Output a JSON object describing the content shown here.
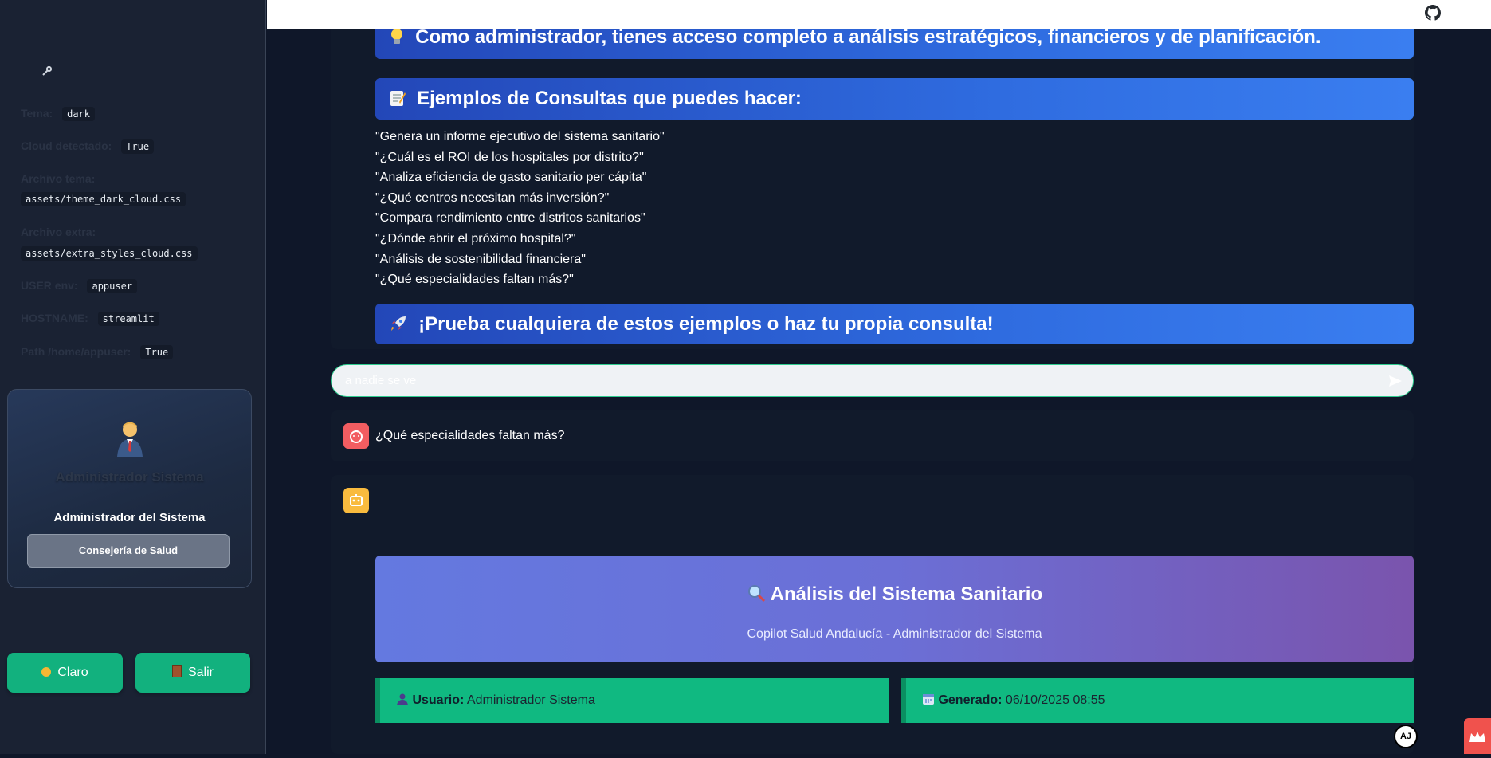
{
  "sidebar": {
    "config": [
      {
        "label": "Tema:",
        "value": "dark"
      },
      {
        "label": "Cloud detectado:",
        "value": "True"
      },
      {
        "label": "Archivo tema:",
        "value": "assets/theme_dark_cloud.css"
      },
      {
        "label": "Archivo extra:",
        "value": "assets/extra_styles_cloud.css"
      },
      {
        "label": "USER env:",
        "value": "appuser"
      },
      {
        "label": "HOSTNAME:",
        "value": "streamlit"
      },
      {
        "label": "Path /home/appuser:",
        "value": "True"
      }
    ],
    "user_card": {
      "avatar_icon": "businessman-emoji-icon",
      "name": "Administrador Sistema",
      "role": "Administrador del Sistema",
      "organization": "Consejería de Salud"
    },
    "buttons": {
      "theme_label": "Claro",
      "logout_label": "Salir"
    }
  },
  "main": {
    "admin_banner": "Como administrador, tienes acceso completo a análisis estratégicos, financieros y de planificación.",
    "examples_title": "Ejemplos de Consultas que puedes hacer:",
    "examples": [
      "\"Genera un informe ejecutivo del sistema sanitario\"",
      "\"¿Cuál es el ROI de los hospitales por distrito?\"",
      "\"Analiza eficiencia de gasto sanitario per cápita\"",
      "\"¿Qué centros necesitan más inversión?\"",
      "\"Compara rendimiento entre distritos sanitarios\"",
      "\"¿Dónde abrir el próximo hospital?\"",
      "\"Análisis de sostenibilidad financiera\"",
      "\"¿Qué especialidades faltan más?\""
    ],
    "cta_banner": "¡Prueba cualquiera de estos ejemplos o haz tu propia consulta!",
    "chat_input": {
      "value": "a nadie se ve"
    },
    "user_message": "¿Qué especialidades faltan más?",
    "report": {
      "title": "Análisis del Sistema Sanitario",
      "subtitle": "Copilot Salud Andalucía - Administrador del Sistema",
      "user_label": "Usuario:",
      "user_value": "Administrador Sistema",
      "generated_label": "Generado:",
      "generated_value": "06/10/2025 08:55"
    }
  },
  "colors": {
    "accent_green": "#10b981",
    "banner_blue": "#2f6ce0",
    "report_purple": "#7a54ad"
  }
}
